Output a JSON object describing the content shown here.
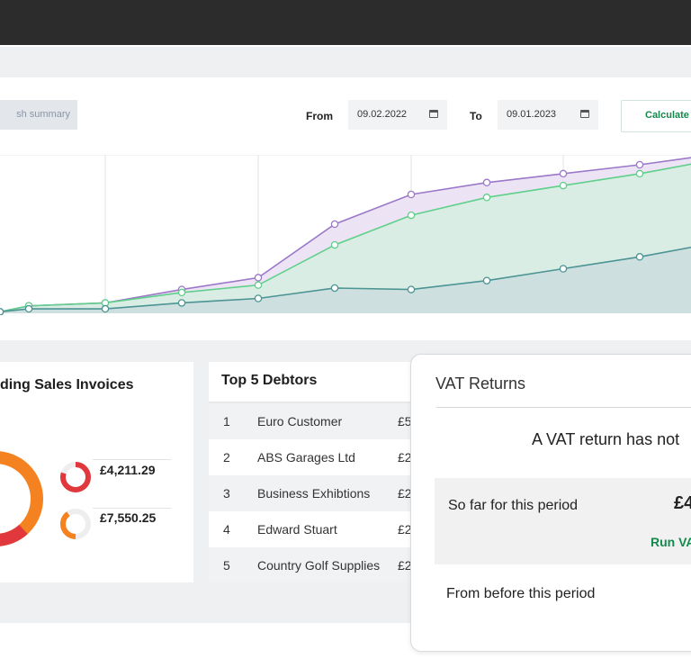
{
  "colors": {
    "accent_green": "#13894c",
    "series_purple": "#9b78c8",
    "series_green": "#5fcf8a",
    "series_teal": "#4d9494",
    "red": "#e0383d",
    "orange": "#f58220"
  },
  "toolbar": {
    "summary_label": "sh summary",
    "from_label": "From",
    "from_date": "09.02.2022",
    "to_label": "To",
    "to_date": "09.01.2023",
    "calendar_icon": "calendar-icon",
    "calculate_label": "Calculate"
  },
  "chart_data": {
    "type": "area",
    "x": [
      0,
      1,
      2,
      3,
      4,
      5,
      6,
      7,
      8,
      9
    ],
    "series": [
      {
        "values": [
          0.5,
          2.5,
          3.5,
          8,
          12,
          30,
          40,
          44,
          47,
          50
        ]
      },
      {
        "values": [
          0.5,
          2.5,
          3.5,
          7,
          9.5,
          23,
          33,
          39,
          43,
          47
        ]
      },
      {
        "values": [
          0.5,
          1.5,
          1.5,
          3.5,
          5,
          8.5,
          8,
          11,
          15,
          19
        ]
      }
    ],
    "grid": "vertical"
  },
  "sales_invoices": {
    "title": "ding Sales Invoices",
    "amount_1": "£4,211.29",
    "amount_2": "£7,550.25",
    "ring_1_fraction": 0.8,
    "ring_2_fraction": 0.4
  },
  "debtors": {
    "title": "Top 5 Debtors",
    "rows": [
      {
        "rank": "1",
        "name": "Euro Customer",
        "amount": "£5"
      },
      {
        "rank": "2",
        "name": "ABS Garages Ltd",
        "amount": "£2"
      },
      {
        "rank": "3",
        "name": "Business Exhibtions",
        "amount": "£2"
      },
      {
        "rank": "4",
        "name": "Edward Stuart",
        "amount": "£2"
      },
      {
        "rank": "5",
        "name": "Country Golf Supplies",
        "amount": "£2"
      }
    ]
  },
  "vat": {
    "title": "VAT Returns",
    "message": "A VAT return has not",
    "so_far_label": "So far for this period",
    "so_far_amount": "£4",
    "run_label": "Run VA",
    "before_label": "From before this period"
  }
}
